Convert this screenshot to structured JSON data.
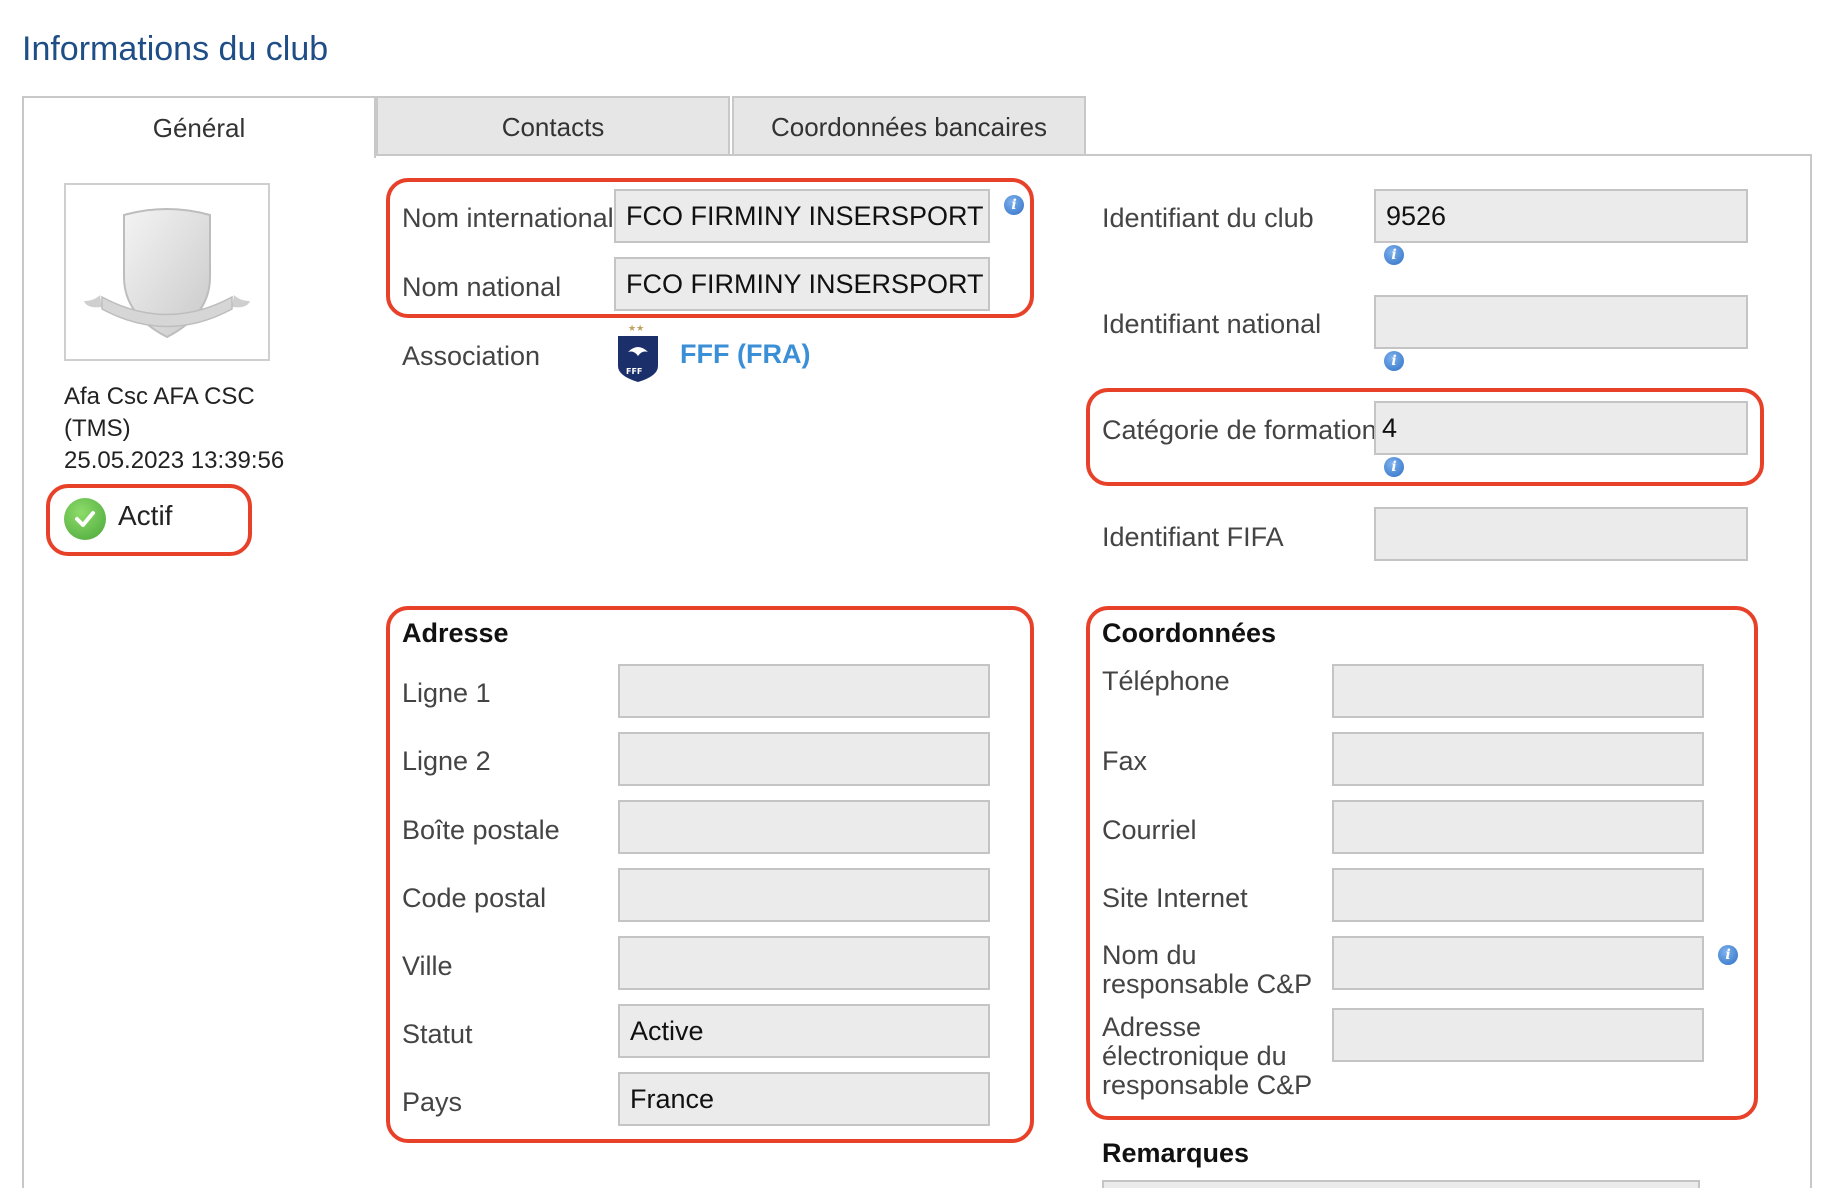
{
  "page": {
    "title": "Informations du club"
  },
  "tabs": [
    {
      "label": "Général"
    },
    {
      "label": "Contacts"
    },
    {
      "label": "Coordonnées bancaires"
    }
  ],
  "club": {
    "owner_line1": "Afa Csc AFA CSC",
    "owner_line2": "(TMS)",
    "timestamp": "25.05.2023 13:39:56",
    "status": "Actif"
  },
  "names": {
    "international_label": "Nom international",
    "international_value": "FCO FIRMINY INSERSPORT",
    "national_label": "Nom national",
    "national_value": "FCO FIRMINY INSERSPORT",
    "association_label": "Association",
    "association_value": "FFF (FRA)",
    "association_badge": "FFF"
  },
  "identifiers": {
    "club_label": "Identifiant du club",
    "club_value": "9526",
    "national_label": "Identifiant national",
    "national_value": "",
    "category_label": "Catégorie de formation",
    "category_value": "4",
    "fifa_label": "Identifiant FIFA",
    "fifa_value": ""
  },
  "address": {
    "title": "Adresse",
    "line1_label": "Ligne 1",
    "line1_value": "",
    "line2_label": "Ligne 2",
    "line2_value": "",
    "po_box_label": "Boîte postale",
    "po_box_value": "",
    "postal_code_label": "Code postal",
    "postal_code_value": "",
    "city_label": "Ville",
    "city_value": "",
    "status_label": "Statut",
    "status_value": "Active",
    "country_label": "Pays",
    "country_value": "France"
  },
  "contact": {
    "title": "Coordonnées",
    "phone_label": "Téléphone",
    "phone_value": "",
    "fax_label": "Fax",
    "fax_value": "",
    "email_label": "Courriel",
    "email_value": "",
    "website_label": "Site Internet",
    "website_value": "",
    "cp_name_label_1": "Nom du",
    "cp_name_label_2": "responsable C&P",
    "cp_name_value": "",
    "cp_email_label_1": "Adresse",
    "cp_email_label_2": "électronique du",
    "cp_email_label_3": "responsable C&P",
    "cp_email_value": ""
  },
  "remarks": {
    "title": "Remarques"
  },
  "icons": {
    "info": "info-icon",
    "status": "check-circle-icon",
    "crest": "shield-crest-icon",
    "association": "fff-logo-icon"
  },
  "colors": {
    "title": "#1f4e87",
    "highlight": "#e8412a",
    "link": "#3b8fd6",
    "field_bg": "#ebebeb",
    "status_green": "#4aa63a"
  }
}
